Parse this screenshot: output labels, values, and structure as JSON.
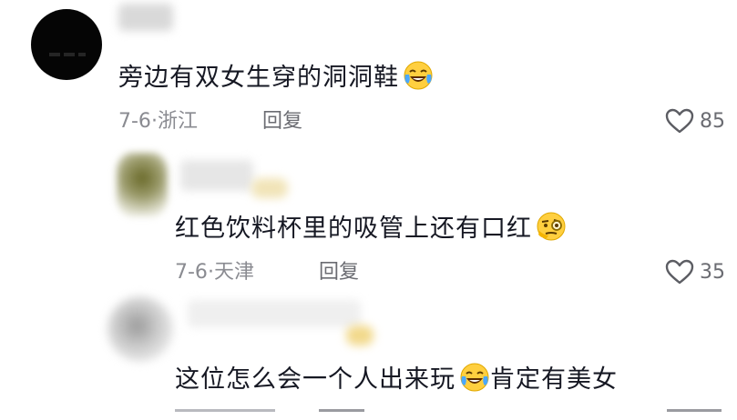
{
  "comments": [
    {
      "text": "旁边有双女生穿的洞洞鞋",
      "date": "7-6",
      "location": "浙江",
      "reply_label": "回复",
      "likes": "85",
      "emoji": "tears-of-joy-emoji"
    },
    {
      "text": "红色饮料杯里的吸管上还有口红",
      "date": "7-6",
      "location": "天津",
      "reply_label": "回复",
      "likes": "35",
      "emoji": "monocle-face-emoji"
    },
    {
      "text": "这位怎么会一个人出来玩",
      "text_after_emoji": "肯定有美女",
      "emoji": "tears-of-joy-emoji"
    }
  ],
  "separator": "·",
  "colors": {
    "text": "#161823",
    "meta": "#8a8b91",
    "reply": "#6b6c72"
  }
}
